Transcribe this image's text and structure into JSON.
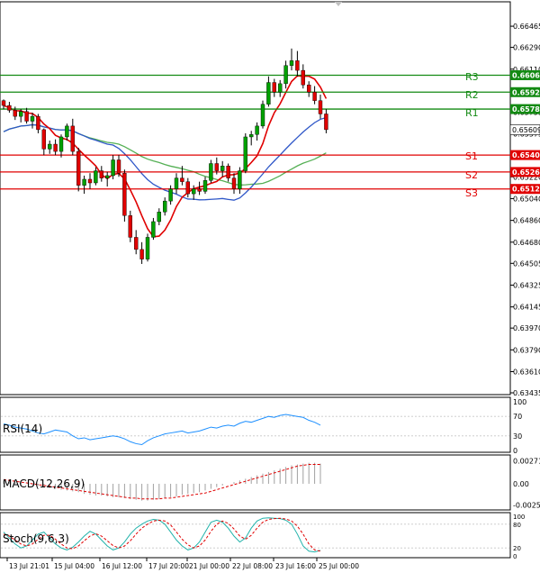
{
  "chart_data": [
    {
      "type": "candlestick",
      "panel": "price",
      "y_ticks": [
        "0.66465",
        "0.66290",
        "0.66110",
        "0.65935",
        "0.65755",
        "0.65575",
        "0.65400",
        "0.65220",
        "0.65040",
        "0.64860",
        "0.64680",
        "0.64505",
        "0.64325",
        "0.64145",
        "0.63970",
        "0.63790",
        "0.63610",
        "0.63435"
      ],
      "ylim": [
        0.63435,
        0.66555
      ],
      "x_ticks": [
        "13 Jul 21:01",
        "15 Jul 04:00",
        "16 Jul 12:00",
        "17 Jul 20:00",
        "21 Jul 00:00",
        "22 Jul 08:00",
        "23 Jul 16:00",
        "25 Jul 00:00"
      ],
      "colors": {
        "up": "#00a000",
        "down": "#e00000",
        "sr_green": "#138a13",
        "sr_red": "#e00000",
        "ma_fast": "#e00000",
        "ma_mid": "#2f57c8",
        "ma_slow": "#55b055"
      },
      "resistance": [
        {
          "name": "R1",
          "value": 0.6578,
          "label": "0.65780"
        },
        {
          "name": "R2",
          "value": 0.6592,
          "label": "0.65920"
        },
        {
          "name": "R3",
          "value": 0.6606,
          "label": "0.66060"
        }
      ],
      "support": [
        {
          "name": "S1",
          "value": 0.654,
          "label": "0.65400"
        },
        {
          "name": "S2",
          "value": 0.6526,
          "label": "0.65260"
        },
        {
          "name": "S3",
          "value": 0.6512,
          "label": "0.65120"
        }
      ],
      "current_price": "0.65609",
      "candles": [
        [
          0.6585,
          0.6586,
          0.6578,
          0.6581
        ],
        [
          0.6581,
          0.6584,
          0.6575,
          0.6577
        ],
        [
          0.6577,
          0.658,
          0.6569,
          0.6572
        ],
        [
          0.6572,
          0.6578,
          0.6567,
          0.6576
        ],
        [
          0.6576,
          0.6579,
          0.6566,
          0.6568
        ],
        [
          0.6568,
          0.6575,
          0.6562,
          0.6572
        ],
        [
          0.6572,
          0.6574,
          0.6558,
          0.6561
        ],
        [
          0.6561,
          0.6562,
          0.654,
          0.6545
        ],
        [
          0.6545,
          0.6552,
          0.6541,
          0.6549
        ],
        [
          0.6549,
          0.6553,
          0.654,
          0.6543
        ],
        [
          0.6543,
          0.6557,
          0.6538,
          0.6555
        ],
        [
          0.6555,
          0.6566,
          0.6552,
          0.6564
        ],
        [
          0.6564,
          0.657,
          0.654,
          0.6543
        ],
        [
          0.6543,
          0.6546,
          0.651,
          0.6515
        ],
        [
          0.6515,
          0.6523,
          0.6508,
          0.652
        ],
        [
          0.652,
          0.6525,
          0.6512,
          0.6517
        ],
        [
          0.6517,
          0.653,
          0.6515,
          0.6527
        ],
        [
          0.6527,
          0.6531,
          0.6518,
          0.6521
        ],
        [
          0.6521,
          0.6526,
          0.6514,
          0.6523
        ],
        [
          0.6523,
          0.654,
          0.652,
          0.6536
        ],
        [
          0.6536,
          0.654,
          0.6522,
          0.6525
        ],
        [
          0.6525,
          0.6528,
          0.6485,
          0.649
        ],
        [
          0.649,
          0.6494,
          0.6468,
          0.6472
        ],
        [
          0.6472,
          0.6478,
          0.6458,
          0.6462
        ],
        [
          0.6462,
          0.6468,
          0.645,
          0.6454
        ],
        [
          0.6454,
          0.6475,
          0.6452,
          0.6472
        ],
        [
          0.6472,
          0.6488,
          0.647,
          0.6485
        ],
        [
          0.6485,
          0.6496,
          0.6482,
          0.6493
        ],
        [
          0.6493,
          0.6505,
          0.649,
          0.6502
        ],
        [
          0.6502,
          0.6515,
          0.6499,
          0.6512
        ],
        [
          0.6512,
          0.6525,
          0.6508,
          0.6521
        ],
        [
          0.6521,
          0.6531,
          0.6515,
          0.6518
        ],
        [
          0.6518,
          0.6521,
          0.6505,
          0.6508
        ],
        [
          0.6508,
          0.6515,
          0.6503,
          0.6512
        ],
        [
          0.6512,
          0.6518,
          0.6507,
          0.651
        ],
        [
          0.651,
          0.6522,
          0.6508,
          0.6519
        ],
        [
          0.6519,
          0.6536,
          0.6517,
          0.6533
        ],
        [
          0.6533,
          0.6538,
          0.6524,
          0.6527
        ],
        [
          0.6527,
          0.6535,
          0.6522,
          0.6531
        ],
        [
          0.6531,
          0.6533,
          0.6518,
          0.6521
        ],
        [
          0.6521,
          0.6525,
          0.6508,
          0.6512
        ],
        [
          0.6512,
          0.653,
          0.6508,
          0.6527
        ],
        [
          0.6527,
          0.6558,
          0.6525,
          0.6555
        ],
        [
          0.6555,
          0.656,
          0.6548,
          0.6557
        ],
        [
          0.6557,
          0.6567,
          0.6552,
          0.6564
        ],
        [
          0.6564,
          0.6585,
          0.6562,
          0.6582
        ],
        [
          0.6582,
          0.6605,
          0.658,
          0.66
        ],
        [
          0.66,
          0.6603,
          0.6588,
          0.6592
        ],
        [
          0.6592,
          0.6602,
          0.6588,
          0.6599
        ],
        [
          0.6599,
          0.6618,
          0.6595,
          0.6614
        ],
        [
          0.6614,
          0.6628,
          0.661,
          0.6618
        ],
        [
          0.6618,
          0.6626,
          0.6605,
          0.661
        ],
        [
          0.661,
          0.6615,
          0.6595,
          0.6598
        ],
        [
          0.6598,
          0.6601,
          0.6588,
          0.6592
        ],
        [
          0.6592,
          0.6597,
          0.6582,
          0.6585
        ],
        [
          0.6585,
          0.659,
          0.657,
          0.6574
        ],
        [
          0.6574,
          0.6578,
          0.6558,
          0.6561
        ]
      ]
    },
    {
      "type": "line",
      "panel": "rsi",
      "title": "RSI(14)",
      "y_ticks": [
        "100",
        "70",
        "30",
        "0"
      ],
      "ylim": [
        0,
        100
      ],
      "color": "#1e90ff",
      "values": [
        55,
        52,
        48,
        46,
        44,
        40,
        36,
        34,
        38,
        42,
        40,
        38,
        30,
        24,
        26,
        22,
        24,
        26,
        28,
        30,
        28,
        24,
        18,
        14,
        12,
        20,
        26,
        30,
        34,
        36,
        38,
        40,
        36,
        38,
        40,
        44,
        48,
        46,
        50,
        52,
        50,
        56,
        60,
        58,
        62,
        66,
        70,
        68,
        72,
        74,
        72,
        70,
        68,
        62,
        58,
        52
      ]
    },
    {
      "type": "line",
      "panel": "macd",
      "title": "MACD(12,26,9)",
      "y_ticks": [
        "0.002713",
        "0.00",
        "-0.002523"
      ],
      "ylim": [
        -0.0029,
        0.003
      ],
      "color": "#e00000",
      "histogram": [
        0.0004,
        0.0003,
        0.0002,
        0.0001,
        0,
        -0.0001,
        -0.0002,
        -0.0003,
        -0.0005,
        -0.0006,
        -0.0007,
        -0.0008,
        -0.0009,
        -0.001,
        -0.0012,
        -0.0013,
        -0.0014,
        -0.0014,
        -0.0015,
        -0.0016,
        -0.0016,
        -0.0017,
        -0.0018,
        -0.0019,
        -0.002,
        -0.002,
        -0.0019,
        -0.0018,
        -0.0017,
        -0.0016,
        -0.0015,
        -0.0013,
        -0.0012,
        -0.0011,
        -0.001,
        -0.0008,
        -0.0006,
        -0.0004,
        -0.0002,
        0,
        0.0002,
        0.0004,
        0.0006,
        0.0008,
        0.001,
        0.0012,
        0.0014,
        0.0016,
        0.0018,
        0.002,
        0.0022,
        0.0023,
        0.0024,
        0.0025,
        0.0025,
        0.0024
      ],
      "signal": [
        0.0005,
        0.0004,
        0.0003,
        0.0002,
        0.0001,
        0,
        -0.0001,
        -0.0002,
        -0.0003,
        -0.0004,
        -0.0005,
        -0.0006,
        -0.0007,
        -0.0008,
        -0.0009,
        -0.001,
        -0.0011,
        -0.0012,
        -0.0013,
        -0.0014,
        -0.0015,
        -0.0016,
        -0.0017,
        -0.0017,
        -0.0018,
        -0.0018,
        -0.0018,
        -0.0018,
        -0.0017,
        -0.0017,
        -0.0016,
        -0.0015,
        -0.0014,
        -0.0013,
        -0.0012,
        -0.0011,
        -0.0009,
        -0.0007,
        -0.0005,
        -0.0003,
        -0.0001,
        0.0001,
        0.0003,
        0.0005,
        0.0007,
        0.0009,
        0.0011,
        0.0013,
        0.0015,
        0.0017,
        0.0019,
        0.0021,
        0.0022,
        0.0023,
        0.0023,
        0.0023
      ]
    },
    {
      "type": "line",
      "panel": "stoch",
      "title": "Stoch(9,6,3)",
      "y_ticks": [
        "100",
        "80",
        "20",
        "0"
      ],
      "ylim": [
        0,
        100
      ],
      "colors": {
        "main": "#20b2aa",
        "signal": "#e00000"
      },
      "main": [
        60,
        45,
        30,
        20,
        25,
        40,
        55,
        60,
        45,
        30,
        20,
        15,
        22,
        35,
        50,
        62,
        55,
        40,
        25,
        15,
        20,
        35,
        55,
        70,
        80,
        88,
        92,
        90,
        80,
        60,
        40,
        25,
        15,
        20,
        35,
        60,
        85,
        90,
        85,
        70,
        50,
        35,
        45,
        70,
        88,
        95,
        96,
        95,
        94,
        90,
        80,
        55,
        25,
        12,
        10,
        14
      ],
      "signal": [
        55,
        50,
        40,
        30,
        25,
        30,
        42,
        52,
        52,
        42,
        30,
        20,
        18,
        25,
        38,
        50,
        56,
        50,
        38,
        26,
        20,
        25,
        38,
        55,
        70,
        80,
        88,
        90,
        88,
        78,
        60,
        42,
        28,
        20,
        25,
        40,
        62,
        80,
        88,
        82,
        68,
        50,
        42,
        52,
        70,
        85,
        92,
        94,
        95,
        93,
        88,
        75,
        55,
        30,
        15,
        12
      ]
    }
  ]
}
